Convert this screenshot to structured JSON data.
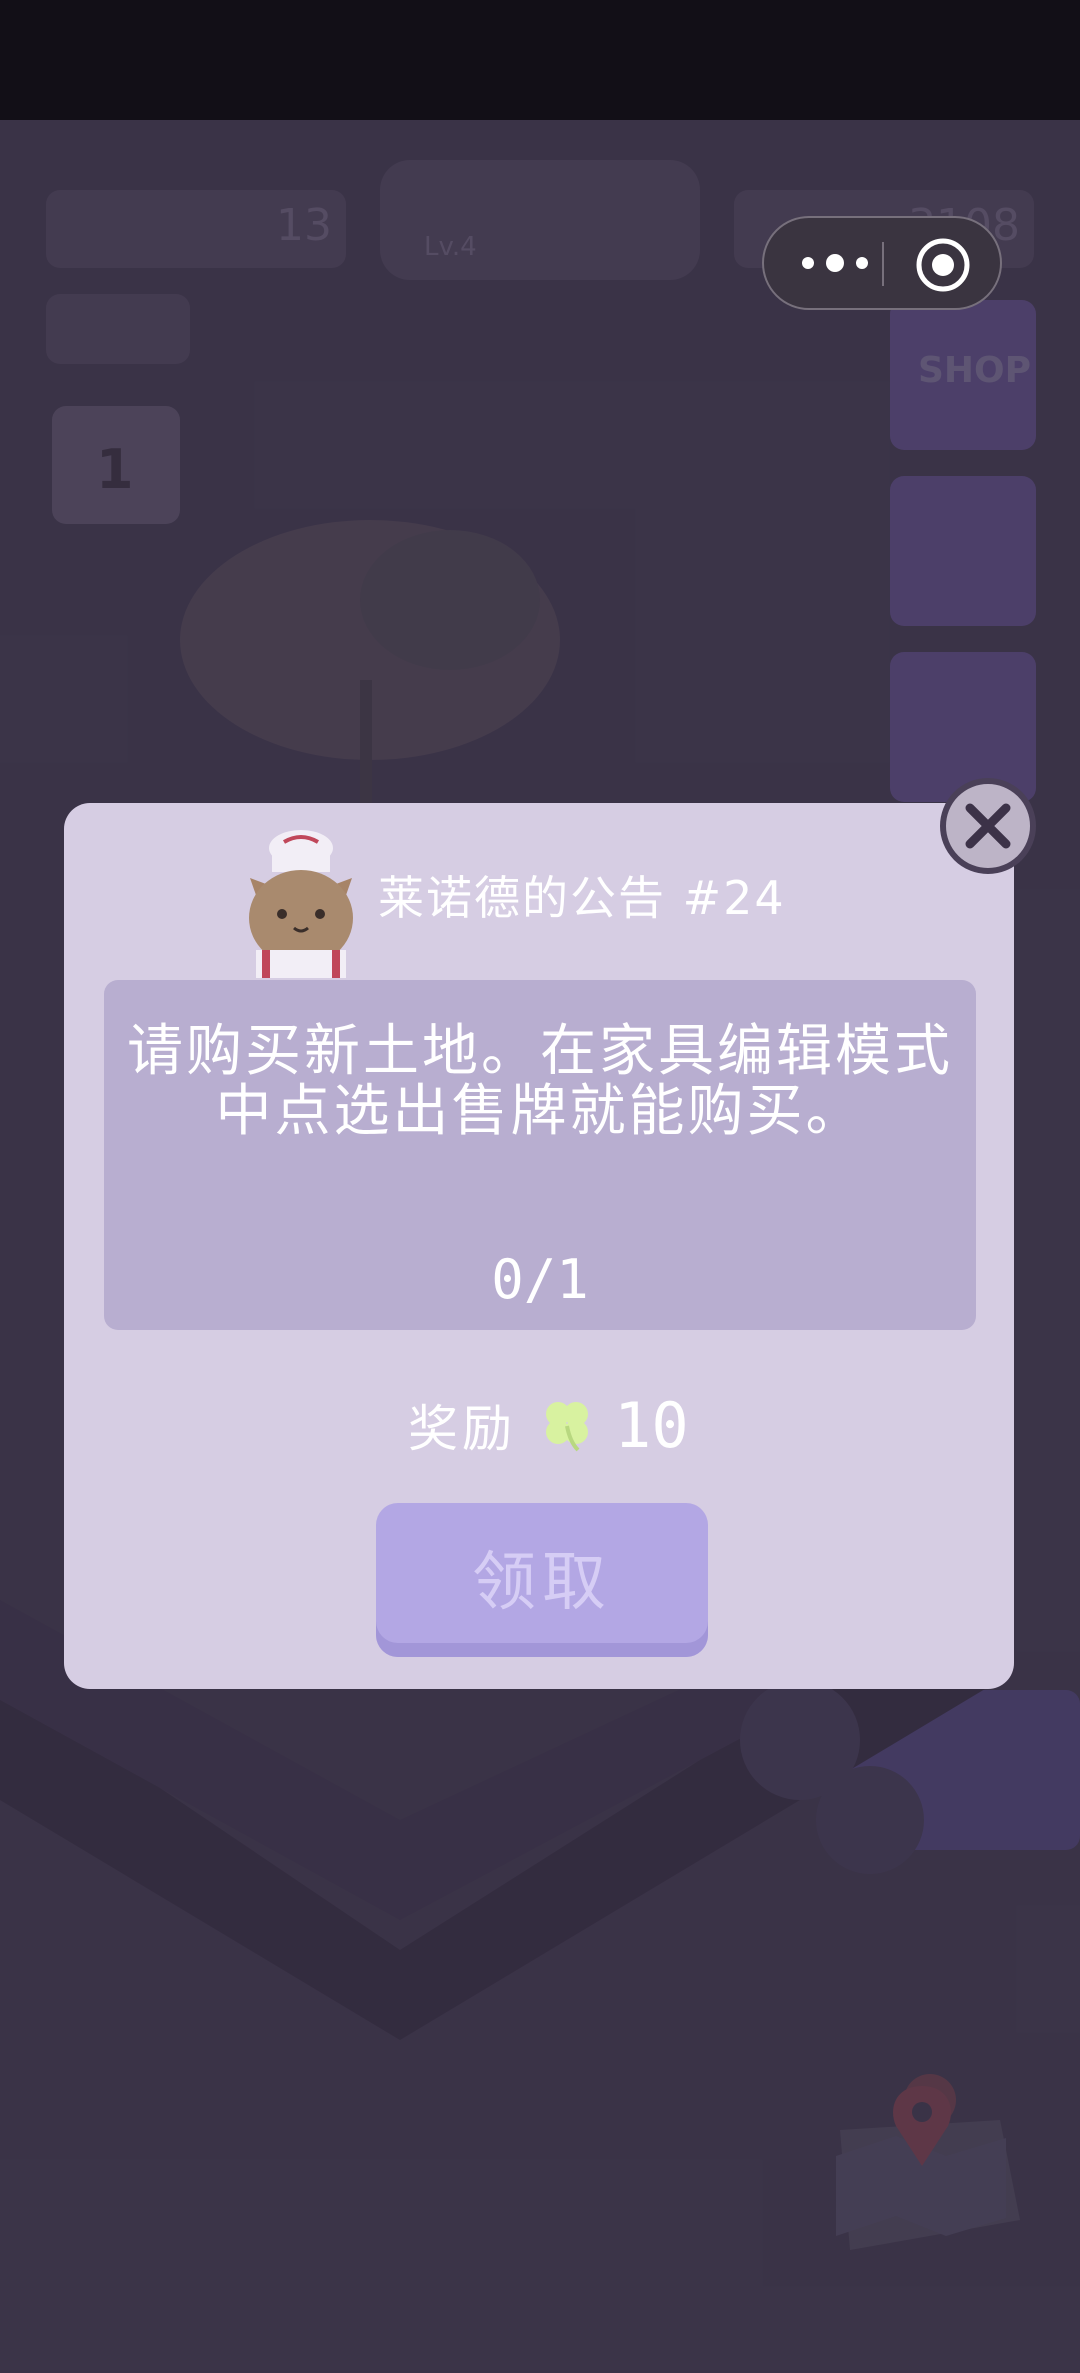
{
  "background": {
    "clover_count": "13",
    "coin_count": "3108",
    "level_label": "Lv.4",
    "calendar_day": "1",
    "shop_label": "SHOP"
  },
  "capsule": {
    "menu_icon": "more-dots-icon",
    "close_icon": "target-close-icon"
  },
  "dialog": {
    "title": "莱诺德的公告 #24",
    "message": "请购买新土地。在家具编辑模式中点选出售牌就能购买。",
    "progress": "0/1",
    "reward_label": "奖励",
    "reward_icon": "clover-icon",
    "reward_amount": "10",
    "claim_label": "领取"
  },
  "colors": {
    "dialog_bg": "#d6cde3",
    "message_box": "#b8aed0",
    "claim_button": "#b3a7e4",
    "clover_green": "#d8f2a0"
  }
}
